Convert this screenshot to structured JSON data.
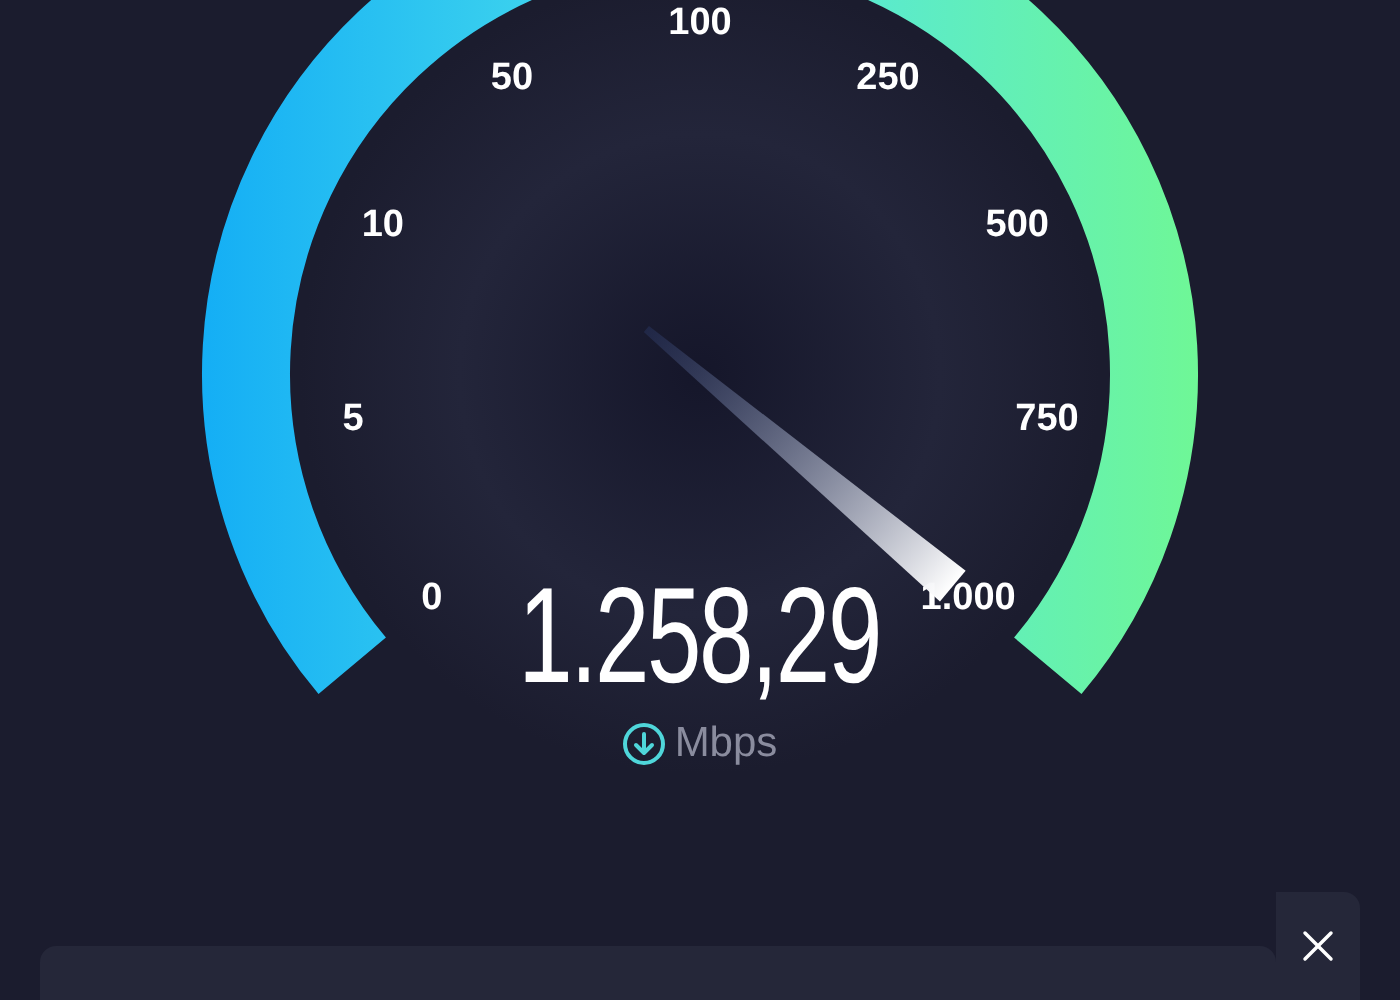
{
  "gauge": {
    "ticks": [
      "0",
      "5",
      "10",
      "50",
      "100",
      "250",
      "500",
      "750",
      "1.000"
    ]
  },
  "reading": {
    "value": "1.258,29",
    "unit": "Mbps"
  }
}
